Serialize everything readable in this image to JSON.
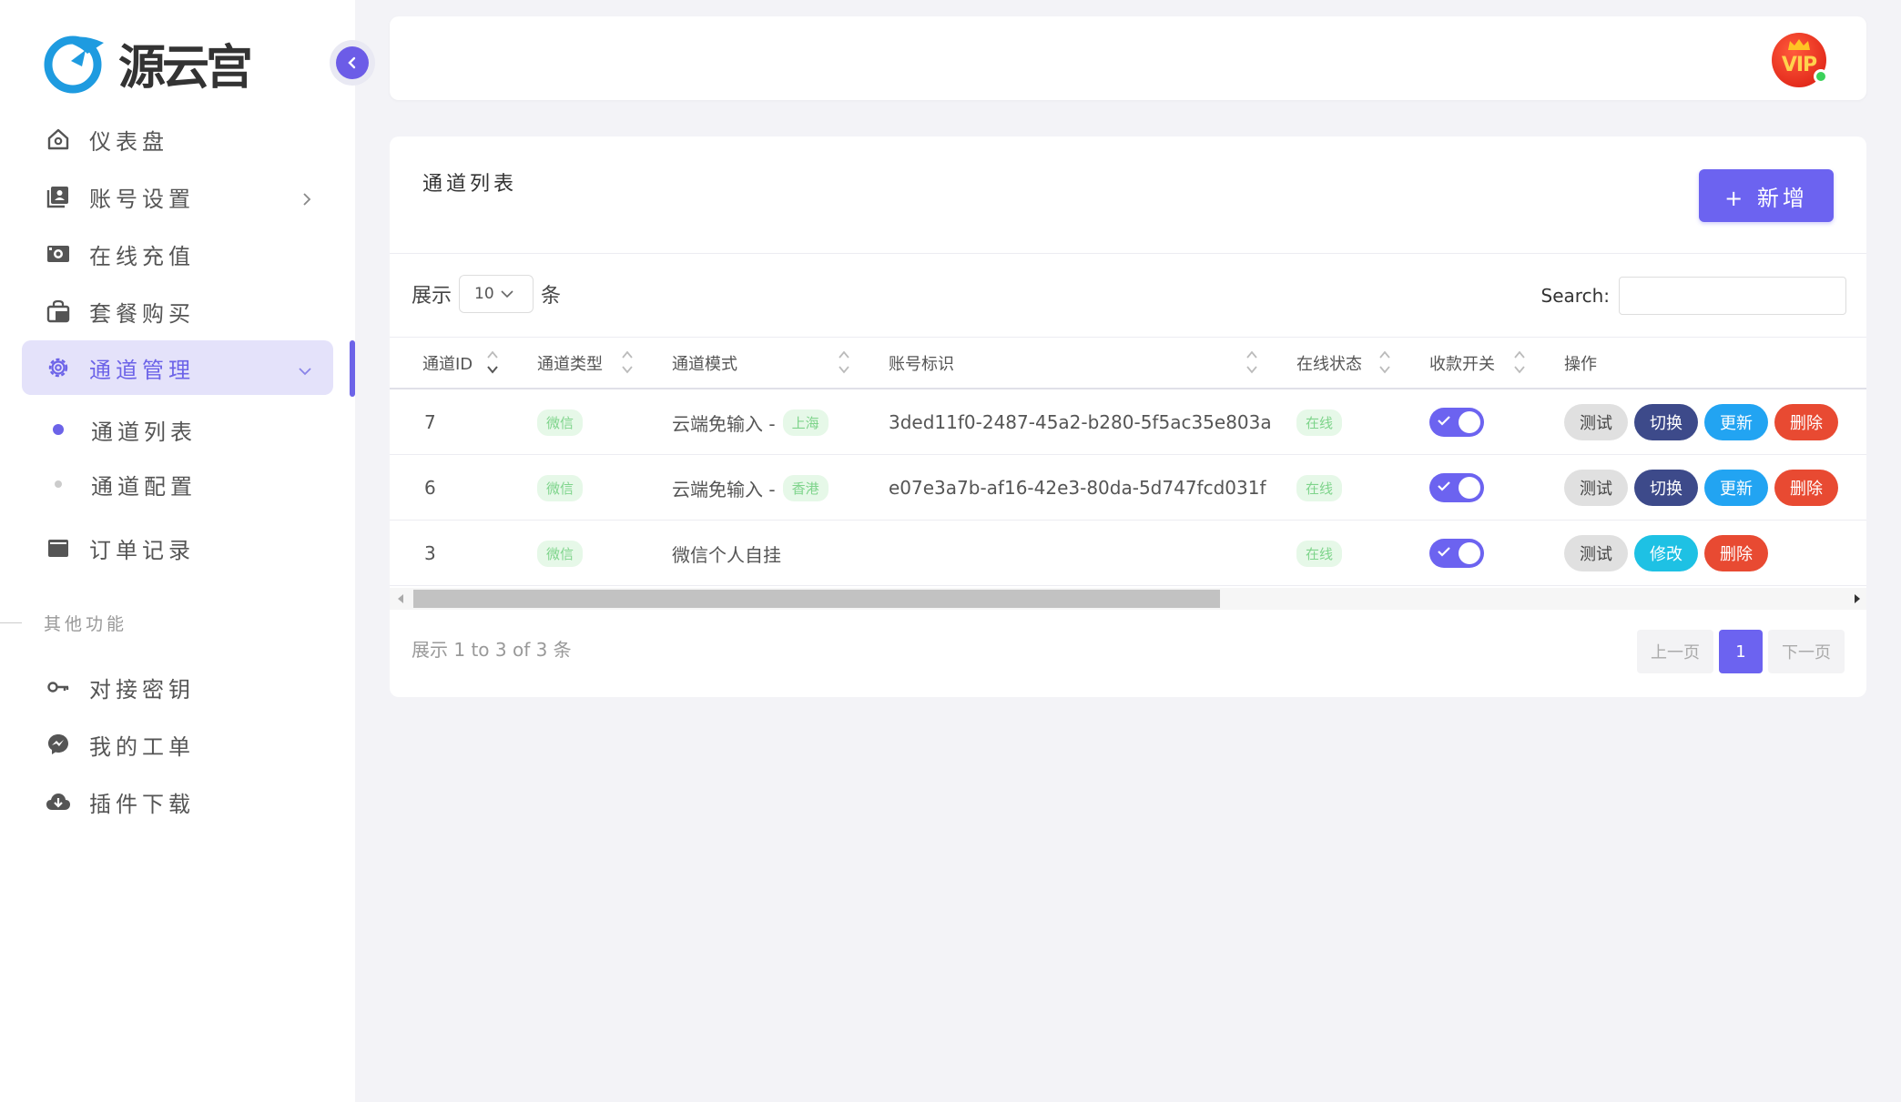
{
  "brand": {
    "logo_text": "源云宫",
    "colors": {
      "accent": "#6c63f0",
      "logo_blue": "#1e9be0"
    }
  },
  "sidebar": {
    "items": [
      {
        "label": "仪表盘",
        "icon": "home-icon"
      },
      {
        "label": "账号设置",
        "icon": "id-card-icon"
      },
      {
        "label": "在线充值",
        "icon": "camera-icon"
      },
      {
        "label": "套餐购买",
        "icon": "shopping-bag-icon"
      },
      {
        "label": "通道管理",
        "icon": "gear-icon"
      },
      {
        "label": "订单记录",
        "icon": "wallet-icon"
      }
    ],
    "sub_items": [
      {
        "label": "通道列表"
      },
      {
        "label": "通道配置"
      }
    ],
    "section_label": "其他功能",
    "other_items": [
      {
        "label": "对接密钥",
        "icon": "key-icon"
      },
      {
        "label": "我的工单",
        "icon": "messenger-icon"
      },
      {
        "label": "插件下载",
        "icon": "cloud-download-icon"
      }
    ]
  },
  "header": {
    "vip_badge": "VIP"
  },
  "card": {
    "title": "通道列表",
    "add_label": "+ 新增",
    "show_prefix": "展示",
    "show_value": "10",
    "show_suffix": "条",
    "search_label": "Search:",
    "search_value": "",
    "columns": [
      "通道ID",
      "通道类型",
      "通道模式",
      "账号标识",
      "在线状态",
      "收款开关",
      "操作"
    ],
    "rows": [
      {
        "id": "7",
        "type": "微信",
        "mode": "云端免输入 -",
        "region": "上海",
        "account": "3ded11f0-2487-45a2-b280-5f5ac35e803a",
        "status": "在线",
        "switch_on": true,
        "actions": [
          "测试",
          "切换",
          "更新",
          "删除"
        ]
      },
      {
        "id": "6",
        "type": "微信",
        "mode": "云端免输入 -",
        "region": "香港",
        "account": "e07e3a7b-af16-42e3-80da-5d747fcd031f",
        "status": "在线",
        "switch_on": true,
        "actions": [
          "测试",
          "切换",
          "更新",
          "删除"
        ]
      },
      {
        "id": "3",
        "type": "微信",
        "mode": "微信个人自挂",
        "region": "",
        "account": "",
        "status": "在线",
        "switch_on": true,
        "actions": [
          "测试",
          "修改",
          "删除"
        ]
      }
    ],
    "info": "展示 1 to 3 of 3 条",
    "pager": {
      "prev": "上一页",
      "current": "1",
      "next": "下一页"
    }
  }
}
